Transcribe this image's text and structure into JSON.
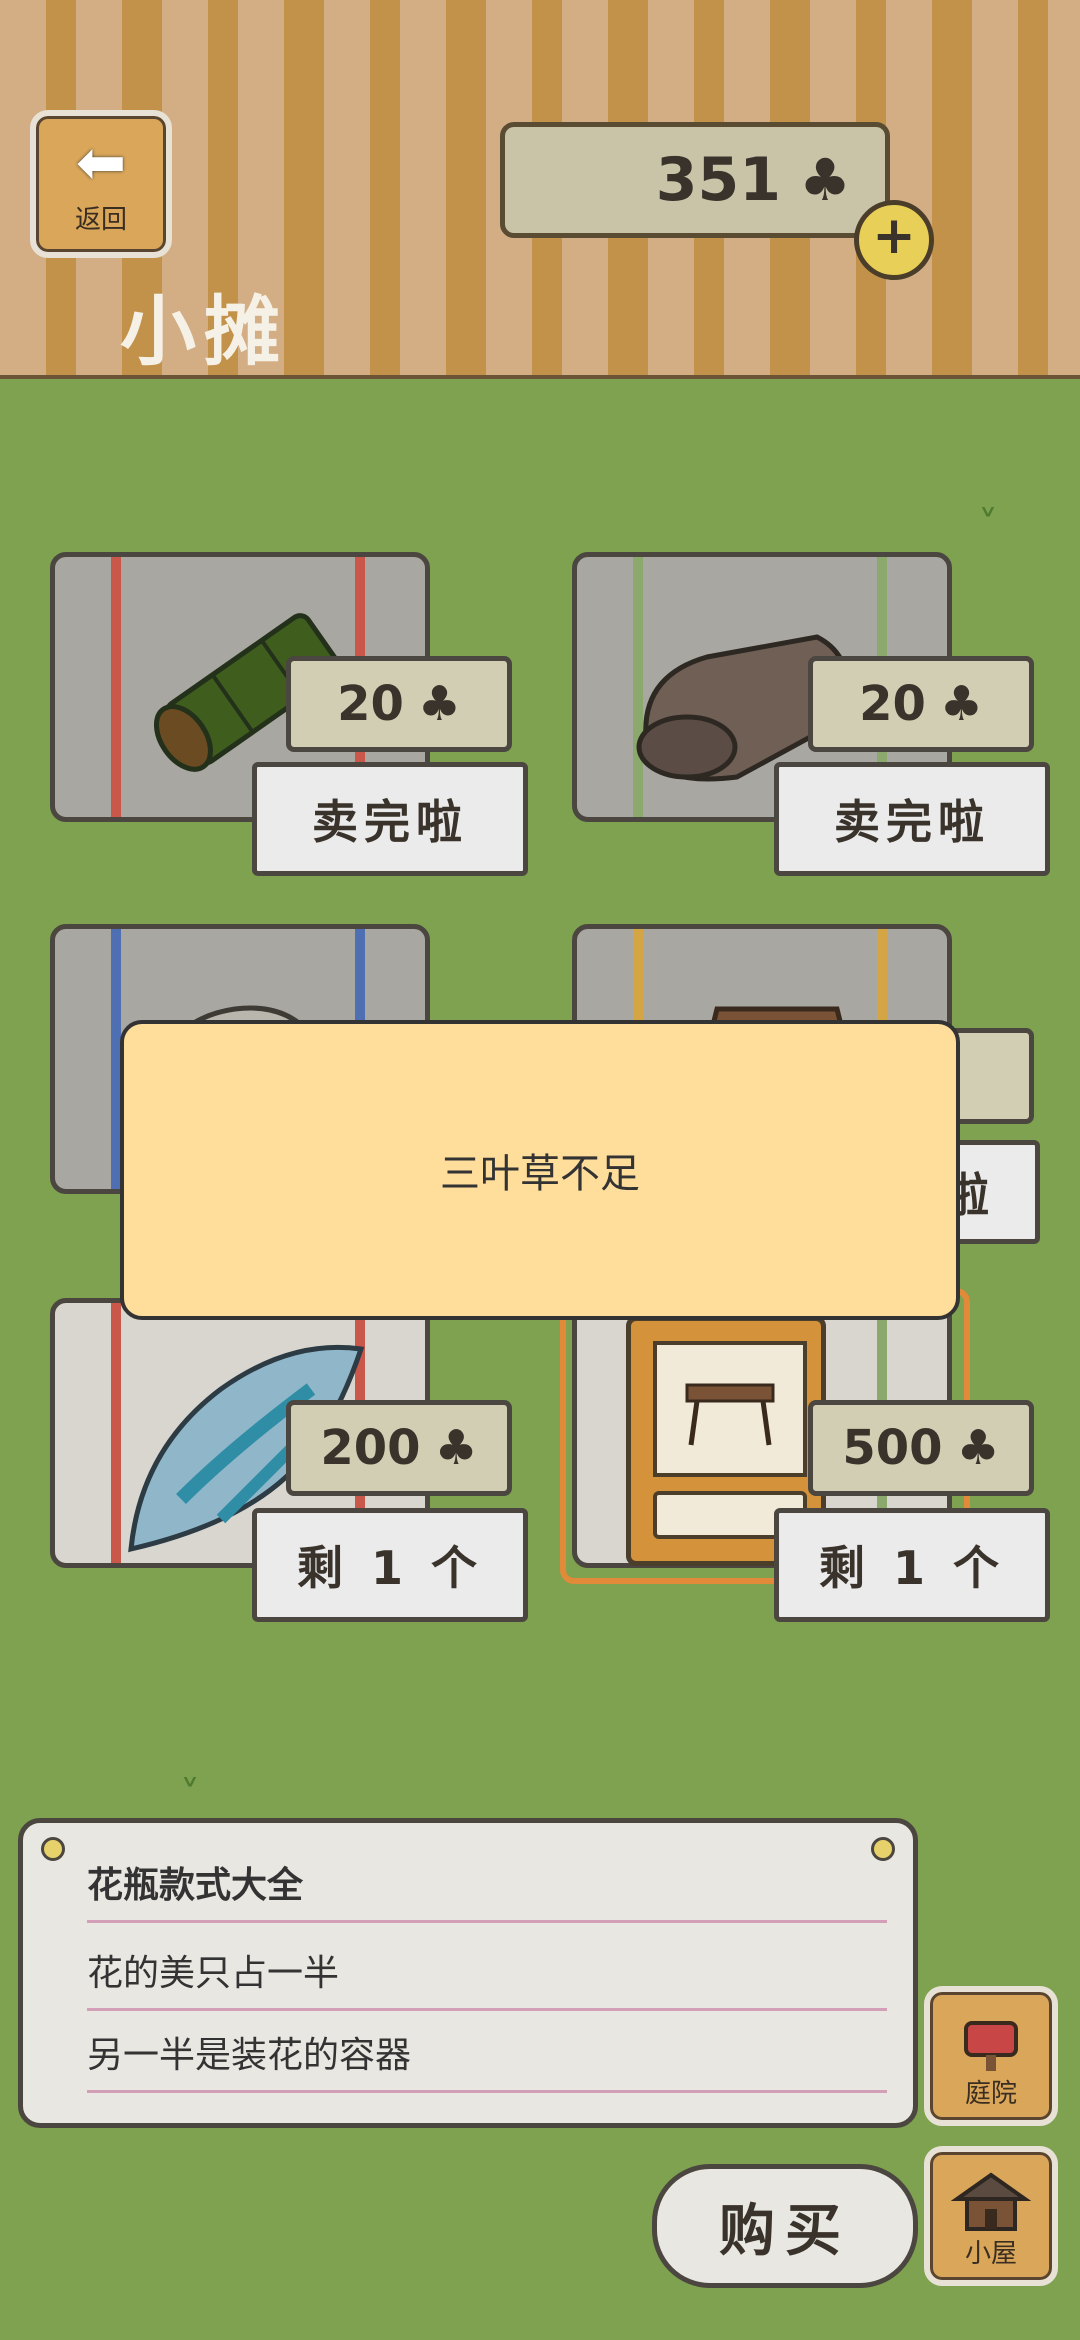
{
  "header": {
    "back_label": "返回",
    "title": "小摊",
    "clover_count": "351"
  },
  "items": [
    {
      "price": "20",
      "status": "卖完啦",
      "name_icon": "bamboo-icon",
      "stripe": "#c9574a"
    },
    {
      "price": "20",
      "status": "卖完啦",
      "name_icon": "sleeping-bag-icon",
      "stripe": "#8ba96c"
    },
    {
      "price": "",
      "status": "",
      "name_icon": "rock-icon",
      "stripe": "#4f6fb3"
    },
    {
      "price": "",
      "status": "啦",
      "name_icon": "box-icon",
      "stripe": "#d4a544"
    },
    {
      "price": "200",
      "status": "剩 1 个",
      "name_icon": "shell-icon",
      "stripe": "#c9574a"
    },
    {
      "price": "500",
      "status": "剩 1 个",
      "name_icon": "book-icon",
      "stripe": "#8ba96c"
    }
  ],
  "dialog": {
    "message": "三叶草不足"
  },
  "info": {
    "title": "花瓶款式大全",
    "line1": "花的美只占一半",
    "line2": "另一半是装花的容器"
  },
  "side": {
    "yard_label": "庭院",
    "house_label": "小屋"
  },
  "buy_label": "购买",
  "colors": {
    "grass": "#7ea24f",
    "dialog": "#ffde9c",
    "selected": "#e08a3a"
  }
}
